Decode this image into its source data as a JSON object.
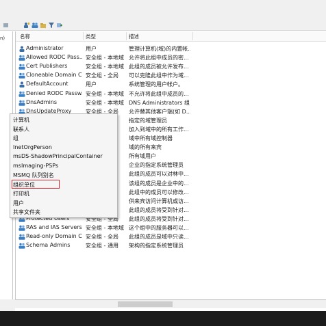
{
  "tree": {
    "fragment": "n)"
  },
  "columns": {
    "name": "名称",
    "type": "类型",
    "desc": "描述"
  },
  "rows": [
    {
      "name": "Administrator",
      "type": "用户",
      "desc": "管理计算机(域)的内置帐...",
      "icon": "user-icon"
    },
    {
      "name": "Allowed RODC Pass...",
      "type": "安全组 - 本地域",
      "desc": "允许将此组中成员的密...",
      "icon": "group-icon"
    },
    {
      "name": "Cert Publishers",
      "type": "安全组 - 本地域",
      "desc": "此组的成员被允许发布...",
      "icon": "group-icon"
    },
    {
      "name": "Cloneable Domain C...",
      "type": "安全组 - 全局",
      "desc": "可以克隆此组中作为域...",
      "icon": "group-icon"
    },
    {
      "name": "DefaultAccount",
      "type": "用户",
      "desc": "系统管理的用户帐户。",
      "icon": "user-icon"
    },
    {
      "name": "Denied RODC Passw...",
      "type": "安全组 - 本地域",
      "desc": "不允许将此组中成员的...",
      "icon": "group-icon"
    },
    {
      "name": "DnsAdmins",
      "type": "安全组 - 本地域",
      "desc": "DNS Administrators 组",
      "icon": "group-icon"
    },
    {
      "name": "DnsUpdateProxy",
      "type": "安全组 - 全局",
      "desc": "允许替其他客户端(如 D...",
      "icon": "group-icon"
    },
    {
      "name": "",
      "type": "",
      "desc": "指定的域管理员",
      "icon": ""
    },
    {
      "name": "",
      "type": "",
      "desc": "加入到域中的所有工作...",
      "icon": ""
    },
    {
      "name": "",
      "type": "",
      "desc": "域中所有域控制器",
      "icon": ""
    },
    {
      "name": "",
      "type": "",
      "desc": "域的所有来宾",
      "icon": ""
    },
    {
      "name": "",
      "type": "",
      "desc": "所有域用户",
      "icon": ""
    },
    {
      "name": "",
      "type": "",
      "desc": "企业的指定系统管理员",
      "icon": ""
    },
    {
      "name": "",
      "type": "",
      "desc": "此组的成员可以对林中...",
      "icon": ""
    },
    {
      "name": "",
      "type": "",
      "desc": "该组的成员是企业中的...",
      "icon": ""
    },
    {
      "name": "",
      "type": "",
      "desc": "此组中的成员可以修改...",
      "icon": ""
    },
    {
      "name": "",
      "type": "",
      "desc": "供来宾访问计算机或访...",
      "icon": ""
    },
    {
      "name": "",
      "type": "",
      "desc": "此组的成员将受到针对...",
      "icon": ""
    },
    {
      "name": "Protected Users",
      "type": "安全组 - 全局",
      "desc": "此组的成员将受到针对...",
      "icon": "group-icon"
    },
    {
      "name": "RAS and IAS Servers",
      "type": "安全组 - 本地域",
      "desc": "这个组中的服务器可以...",
      "icon": "group-icon"
    },
    {
      "name": "Read-only Domain C...",
      "type": "安全组 - 全局",
      "desc": "此组的成员是域中只读...",
      "icon": "group-icon"
    },
    {
      "name": "Schema Admins",
      "type": "安全组 - 通用",
      "desc": "架构的指定系统管理员",
      "icon": "group-icon"
    }
  ],
  "menu": {
    "items": [
      "计算机",
      "联系人",
      "组",
      "InetOrgPerson",
      "msDS-ShadowPrincipalContainer",
      "msImaging-PSPs",
      "MSMQ 队列别名",
      "组织单位",
      "打印机",
      "用户",
      "共享文件夹"
    ],
    "highlighted": "组织单位"
  },
  "colors": {
    "highlight_border": "#d7262e",
    "user_icon": "#3a6ea5",
    "group_icon": "#3a7fc4"
  }
}
